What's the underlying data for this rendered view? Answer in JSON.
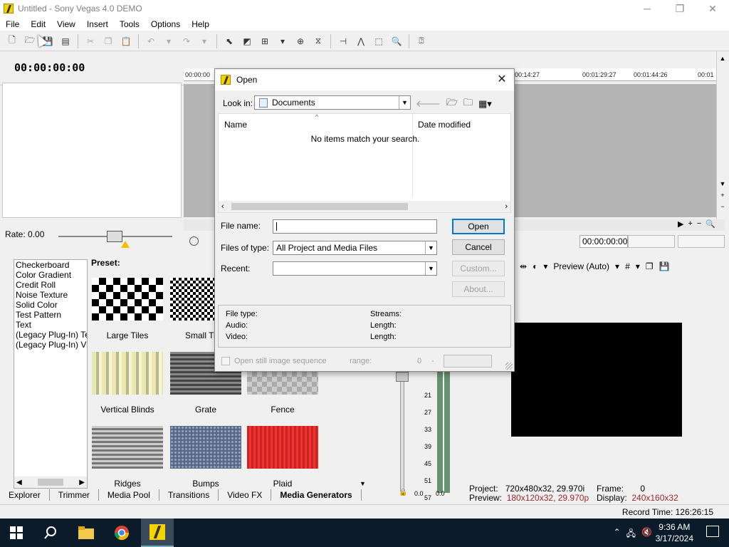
{
  "window": {
    "title": "Untitled - Sony Vegas 4.0 DEMO",
    "minimize": "─",
    "restore": "❐",
    "close": "✕"
  },
  "menu": [
    "File",
    "Edit",
    "View",
    "Insert",
    "Tools",
    "Options",
    "Help"
  ],
  "timecode": "00:00:00:00",
  "ruler": [
    "00:00:00",
    "00:14:27",
    "00:01:29:27",
    "00:01:44:26",
    "00:01"
  ],
  "rate": {
    "label": "Rate: 0.00"
  },
  "status_timecode": "00:00:00:00",
  "generators": {
    "list": [
      "Checkerboard",
      "Color Gradient",
      "Credit Roll",
      "Noise Texture",
      "Solid Color",
      "Test Pattern",
      "Text",
      "(Legacy Plug-In) Tex",
      "(Legacy Plug-In) Vide"
    ],
    "preset_label": "Preset:",
    "presets": [
      "Large Tiles",
      "Small Tiles",
      "Vertical Blinds",
      "Grate",
      "Fence",
      "Ridges",
      "Bumps",
      "Plaid"
    ]
  },
  "tabs": [
    "Explorer",
    "Trimmer",
    "Media Pool",
    "Transitions",
    "Video FX",
    "Media Generators"
  ],
  "meter_ticks": [
    "21",
    "27",
    "33",
    "39",
    "45",
    "51",
    "57"
  ],
  "meter_bottom": [
    "0.0",
    "0.0"
  ],
  "preview": {
    "mode": "Preview (Auto)",
    "project_label": "Project:",
    "project_value": "720x480x32, 29.970i",
    "preview_label": "Preview:",
    "preview_value": "180x120x32, 29.970p",
    "frame_label": "Frame:",
    "frame_value": "0",
    "display_label": "Display:",
    "display_value": "240x160x32"
  },
  "record_time": "Record Time: 126:26:15",
  "dialog": {
    "title": "Open",
    "look_in_label": "Look in:",
    "look_in_value": "Documents",
    "col_name": "Name",
    "col_date": "Date modified",
    "empty_msg": "No items match your search.",
    "file_name_label": "File name:",
    "file_name_value": "",
    "files_of_type_label": "Files of type:",
    "files_of_type_value": "All Project and Media Files",
    "recent_label": "Recent:",
    "recent_value": "",
    "btn_open": "Open",
    "btn_cancel": "Cancel",
    "btn_custom": "Custom...",
    "btn_about": "About...",
    "info": {
      "file_type": "File type:",
      "audio": "Audio:",
      "video": "Video:",
      "streams": "Streams:",
      "length1": "Length:",
      "length2": "Length:"
    },
    "still_seq": "Open still image sequence",
    "range_label": "range:",
    "range_start": "0",
    "range_dash": "-"
  },
  "taskbar": {
    "time": "9:36 AM",
    "date": "3/17/2024"
  },
  "colors": {
    "accent": "#0078d7",
    "taskbar": "#0c1b2a",
    "preview_red": "#a0282c",
    "vegas_yellow": "#f5d300"
  }
}
